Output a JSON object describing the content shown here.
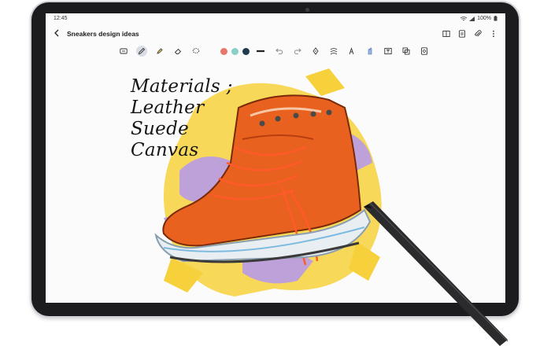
{
  "status_bar": {
    "time": "12:45",
    "battery": "100%"
  },
  "app_bar": {
    "title": "Sneakers design ideas"
  },
  "toolbar": {
    "pen_colors": [
      "#e8776b",
      "#8ccfc8",
      "#1f3b4d"
    ],
    "stroke_color": "#222222"
  },
  "canvas": {
    "handwriting_lines": [
      "Materials ;",
      "Leather",
      "Suede",
      "Canvas"
    ],
    "colors": {
      "shoe": "#e8611f",
      "splash_yellow": "#f6d13b",
      "splash_purple": "#b79be8",
      "sole": "#e9eef2"
    }
  },
  "icons": {
    "back": "arrow-left-icon",
    "book": "book-view-icon",
    "layout": "page-layout-icon",
    "attach": "paperclip-icon",
    "more": "more-vertical-icon",
    "undo": "undo-icon",
    "redo": "redo-icon"
  }
}
